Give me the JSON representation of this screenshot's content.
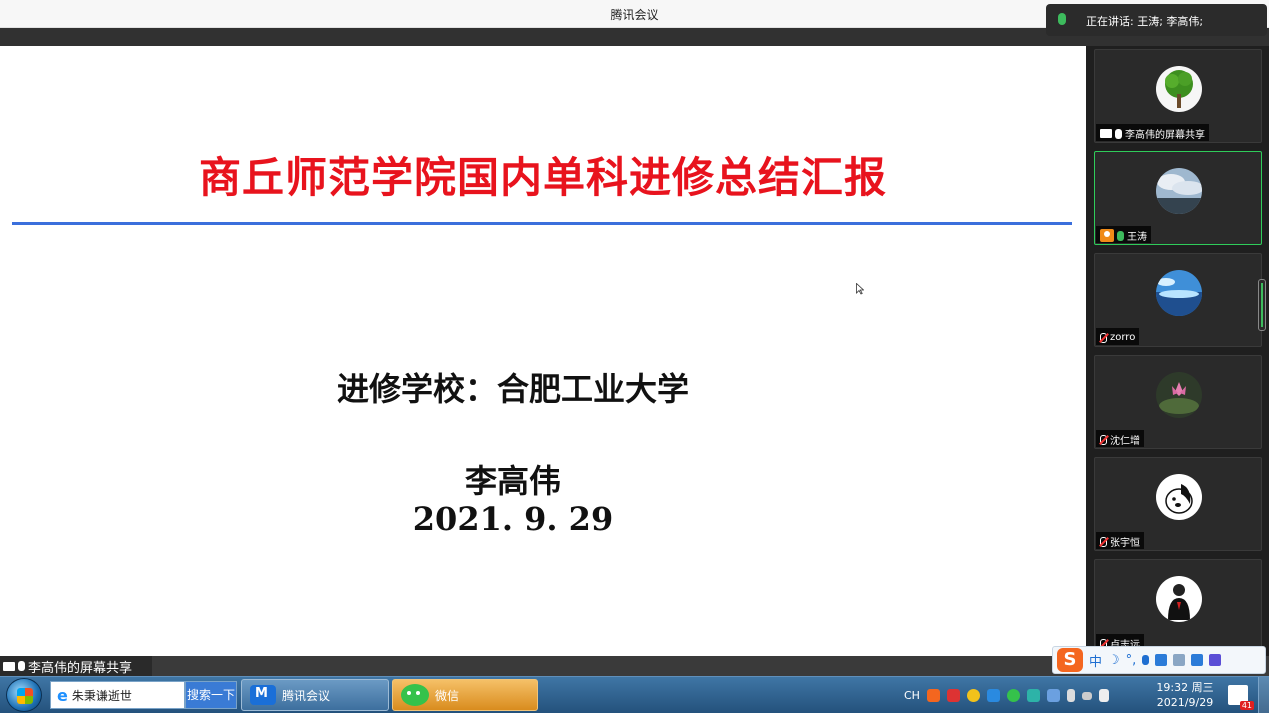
{
  "window": {
    "title": "腾讯会议"
  },
  "speaking_banner": {
    "text": "正在讲话: 王涛; 李高伟;"
  },
  "slide": {
    "title": "商丘师范学院国内单科进修总结汇报",
    "school_line": "进修学校：合肥工业大学",
    "presenter": "李高伟",
    "date": "2021. 9. 29",
    "colors": {
      "title": "#e8131d",
      "rule": "#3b6fdc"
    }
  },
  "participants": [
    {
      "name": "李高伟的屏幕共享",
      "avatar_icon": "tree-avatar",
      "mic": "on",
      "sharing": true,
      "active": false
    },
    {
      "name": "王涛",
      "avatar_icon": "sky-landscape-avatar",
      "mic": "on-speaking",
      "host": true,
      "active": true
    },
    {
      "name": "zorro",
      "avatar_icon": "lake-avatar",
      "mic": "muted",
      "active": false
    },
    {
      "name": "沈仁增",
      "avatar_icon": "lotus-avatar",
      "mic": "muted",
      "active": false
    },
    {
      "name": "张宇恒",
      "avatar_icon": "cartoon-dog-avatar",
      "mic": "muted",
      "active": false
    },
    {
      "name": "卢志远",
      "avatar_icon": "person-avatar",
      "mic": "muted",
      "active": false
    }
  ],
  "share_label": "李高伟的屏幕共享",
  "ime": {
    "logo": "S",
    "lang": "中"
  },
  "taskbar": {
    "search_text": "朱秉谦逝世",
    "search_button": "搜索一下",
    "apps": [
      {
        "label": "腾讯会议",
        "icon": "tencent-meeting-icon"
      },
      {
        "label": "微信",
        "icon": "wechat-icon"
      }
    ],
    "tray_lang": "CH",
    "time": "19:32 周三",
    "date": "2021/9/29",
    "notification_count": "41"
  }
}
